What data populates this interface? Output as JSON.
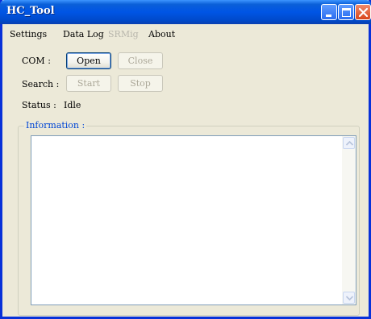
{
  "window": {
    "title": "HC_Tool"
  },
  "menu": {
    "items": [
      {
        "label": "Settings",
        "enabled": true
      },
      {
        "label": "Data Log",
        "enabled": true
      },
      {
        "label": "SRMig",
        "enabled": false
      },
      {
        "label": "About",
        "enabled": true
      }
    ]
  },
  "com": {
    "label": "COM :",
    "open_label": "Open",
    "close_label": "Close"
  },
  "search": {
    "label": "Search :",
    "start_label": "Start",
    "stop_label": "Stop"
  },
  "status": {
    "label": "Status :",
    "value": "Idle"
  },
  "information": {
    "title": "Information :",
    "text": ""
  },
  "icons": {
    "minimize": "minimize-icon",
    "maximize": "maximize-icon",
    "close": "close-icon",
    "scroll_up": "scroll-up-arrow-icon",
    "scroll_down": "scroll-down-arrow-icon"
  },
  "colors": {
    "titlebar": "#0055e5",
    "window_bg": "#ece9d8",
    "group_title": "#0046d5",
    "disabled_text": "#aca899"
  }
}
